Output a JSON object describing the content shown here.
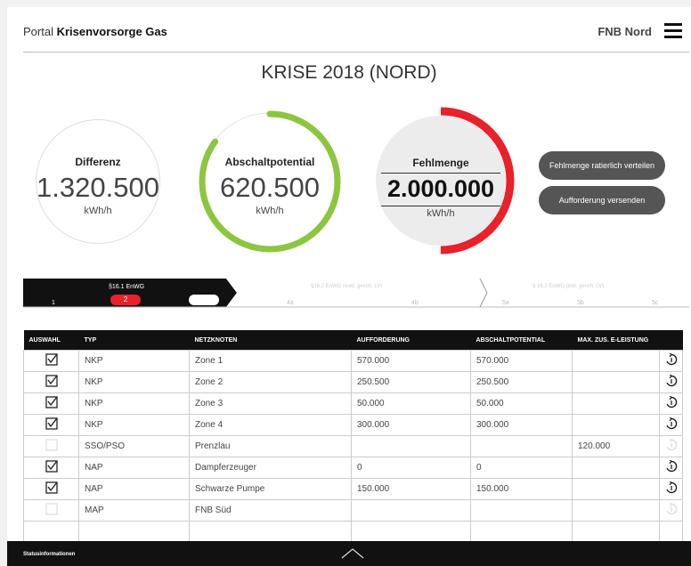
{
  "header": {
    "portal_prefix": "Portal",
    "portal_name": "Krisenvorsorge Gas",
    "org": "FNB Nord",
    "menu_icon": "hamburger-icon"
  },
  "page_title": "KRISE 2018 (NORD)",
  "metrics": {
    "differenz": {
      "label": "Differenz",
      "value": "1.320.500",
      "unit": "kWh/h"
    },
    "abschaltpotential": {
      "label": "Abschaltpotential",
      "value": "620.500",
      "unit": "kWh/h",
      "ring_color": "#8cc63f",
      "ring_fraction": 0.85
    },
    "fehlmenge": {
      "label": "Fehlmenge",
      "value": "2.000.000",
      "unit": "kWh/h",
      "ring_color": "#e8212b",
      "ring_fraction": 0.5
    }
  },
  "buttons": {
    "distribute": "Fehlmenge ratierlich verteilen",
    "send": "Aufforderung versenden"
  },
  "steps": {
    "s1_title": "§16.1 EnWG",
    "s1_num": "1",
    "s1_badge": "2",
    "s2_title": "§16.2 EnWG (exkl. gesch. LV)",
    "s2_a": "4a",
    "s2_b": "4b",
    "s3_title": "§ 16.2 EnWG (inkl. gesch. LV)",
    "s3_a": "5a",
    "s3_b": "5b",
    "s3_c": "5c"
  },
  "table": {
    "headers": [
      "AUSWAHL",
      "TYP",
      "NETZKNOTEN",
      "AUFFORDERUNG",
      "ABSCHALTPOTENTIAL",
      "MAX. ZUS. E-LEISTUNG"
    ],
    "rows": [
      {
        "checked": true,
        "typ": "NKP",
        "netzknoten": "Zone 1",
        "aufforderung": "570.000",
        "abschalt": "570.000",
        "max": ""
      },
      {
        "checked": true,
        "typ": "NKP",
        "netzknoten": "Zone 2",
        "aufforderung": "250.500",
        "abschalt": "250.500",
        "max": ""
      },
      {
        "checked": true,
        "typ": "NKP",
        "netzknoten": "Zone 3",
        "aufforderung": "50.000",
        "abschalt": "50.000",
        "max": ""
      },
      {
        "checked": true,
        "typ": "NKP",
        "netzknoten": "Zone 4",
        "aufforderung": "300.000",
        "abschalt": "300.000",
        "max": ""
      },
      {
        "checked": false,
        "typ": "SSO/PSO",
        "netzknoten": "Prenzlau",
        "aufforderung": "",
        "abschalt": "",
        "max": "120.000"
      },
      {
        "checked": true,
        "typ": "NAP",
        "netzknoten": "Dampferzeuger",
        "aufforderung": "0",
        "abschalt": "0",
        "max": ""
      },
      {
        "checked": true,
        "typ": "NAP",
        "netzknoten": "Schwarze Pumpe",
        "aufforderung": "150.000",
        "abschalt": "150.000",
        "max": ""
      },
      {
        "checked": false,
        "typ": "MAP",
        "netzknoten": "FNB Süd",
        "aufforderung": "",
        "abschalt": "",
        "max": ""
      }
    ]
  },
  "status_bar": {
    "label": "Statusinformationen",
    "toggle_icon": "chevron-up-icon"
  }
}
